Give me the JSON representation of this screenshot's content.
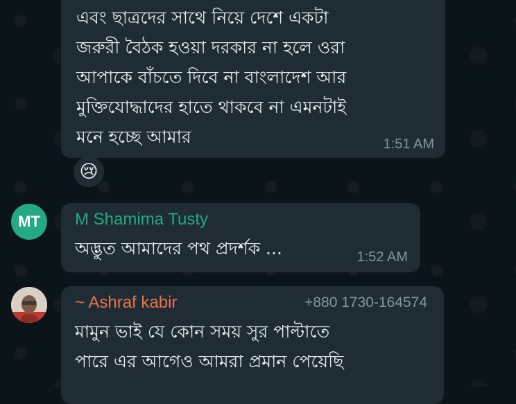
{
  "messages": [
    {
      "lines": [
        "এবং ছাত্রদের সাথে নিয়ে দেশে একটা",
        "জরুরী বৈঠক হওয়া দরকার না হলে ওরা",
        "আপাকে বাঁচতে দিবে না বাংলাদেশ আর",
        "মুক্তিযোদ্ধাদের হাতে থাকবে না এমনটাই",
        "মনে হচ্ছে আমার"
      ],
      "time": "1:51 AM",
      "reaction": "😢"
    },
    {
      "sender": "M Shamima Tusty",
      "avatar_initials": "MT",
      "text": "অদ্ভুত আমাদের পথ প্রদর্শক ...",
      "time": "1:52 AM",
      "sender_color": "#25a884"
    },
    {
      "sender": "~ Ashraf kabir",
      "phone": "+880 1730-164574",
      "lines": [
        "মামুন ভাই যে কোন সময় সুর পাল্টাতে",
        "পারে এর আগেও আমরা প্রমান পেয়েছি"
      ],
      "sender_color": "#e8744f"
    }
  ]
}
